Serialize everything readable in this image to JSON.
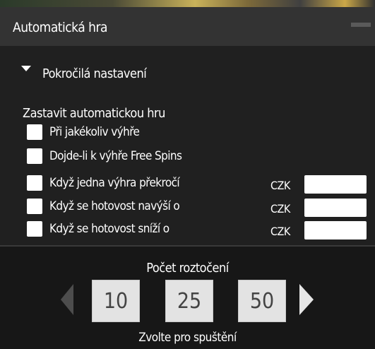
{
  "window": {
    "title": "Automatická hra"
  },
  "advanced": {
    "label": "Pokročilá nastavení"
  },
  "stop": {
    "title": "Zastavit automatickou hru",
    "options": [
      {
        "label": "Při jakékoliv výhře",
        "checked": false
      },
      {
        "label": "Dojde-li k výhře Free Spins",
        "checked": false
      },
      {
        "label": "Když jedna výhra překročí",
        "checked": false,
        "currency": "CZK",
        "value": ""
      },
      {
        "label": "Když se hotovost navýší o",
        "checked": false,
        "currency": "CZK",
        "value": ""
      },
      {
        "label": "Když se hotovost sníží o",
        "checked": false,
        "currency": "CZK",
        "value": ""
      }
    ]
  },
  "spins": {
    "title": "Počet roztočení",
    "values": [
      "10",
      "25",
      "50"
    ],
    "start_label": "Zvolte pro spuštění"
  },
  "colors": {
    "title_bar": "#333333",
    "panel": "#202020",
    "bottom": "#171717",
    "button": "#e3e3e3",
    "text": "#ffffff"
  }
}
